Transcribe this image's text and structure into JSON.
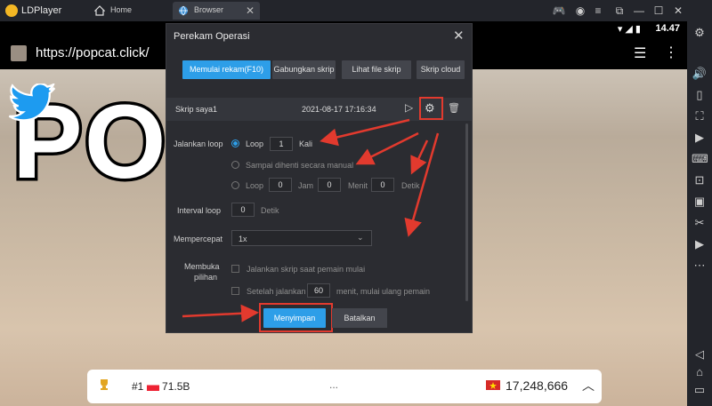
{
  "emulator": {
    "app_name": "LDPlayer",
    "tabs": [
      {
        "label": "Home"
      },
      {
        "label": "Browser"
      }
    ]
  },
  "android": {
    "time": "14.47",
    "url": "https://popcat.click/",
    "page_title": "POPCAT",
    "leaderboard": {
      "rank": "#1",
      "rank_value": "71.5B",
      "dots": "...",
      "score": "17,248,666"
    }
  },
  "dialog": {
    "title": "Perekam Operasi",
    "buttons": {
      "record": "Memulai rekam(F10)",
      "merge": "Gabungkan skrip",
      "view": "Lihat file skrip",
      "cloud": "Skrip cloud"
    },
    "script": {
      "name": "Skrip saya1",
      "datetime": "2021-08-17 17:16:34"
    },
    "loop": {
      "label": "Jalankan loop",
      "option_loop": "Loop",
      "loop_count": "1",
      "loop_unit": "Kali",
      "option_manual": "Sampai dihenti secara manual",
      "option_timed": "Loop",
      "jam_value": "0",
      "jam_label": "Jam",
      "menit_value": "0",
      "menit_label": "Menit",
      "detik_value": "0",
      "detik_label": "Detik"
    },
    "interval": {
      "label": "Interval loop",
      "value": "0",
      "unit": "Detik"
    },
    "speed": {
      "label": "Mempercepat",
      "value": "1x"
    },
    "options": {
      "label_line1": "Membuka",
      "label_line2": "pilihan",
      "run_on_start": "Jalankan skrip saat pemain mulai",
      "after_prefix": "Setelah jalankan",
      "after_value": "60",
      "after_suffix": "menit, mulai ulang pemain"
    },
    "save": "Menyimpan",
    "cancel": "Batalkan"
  },
  "colors": {
    "accent": "#2d9ee8",
    "highlight": "#e23a2e"
  }
}
